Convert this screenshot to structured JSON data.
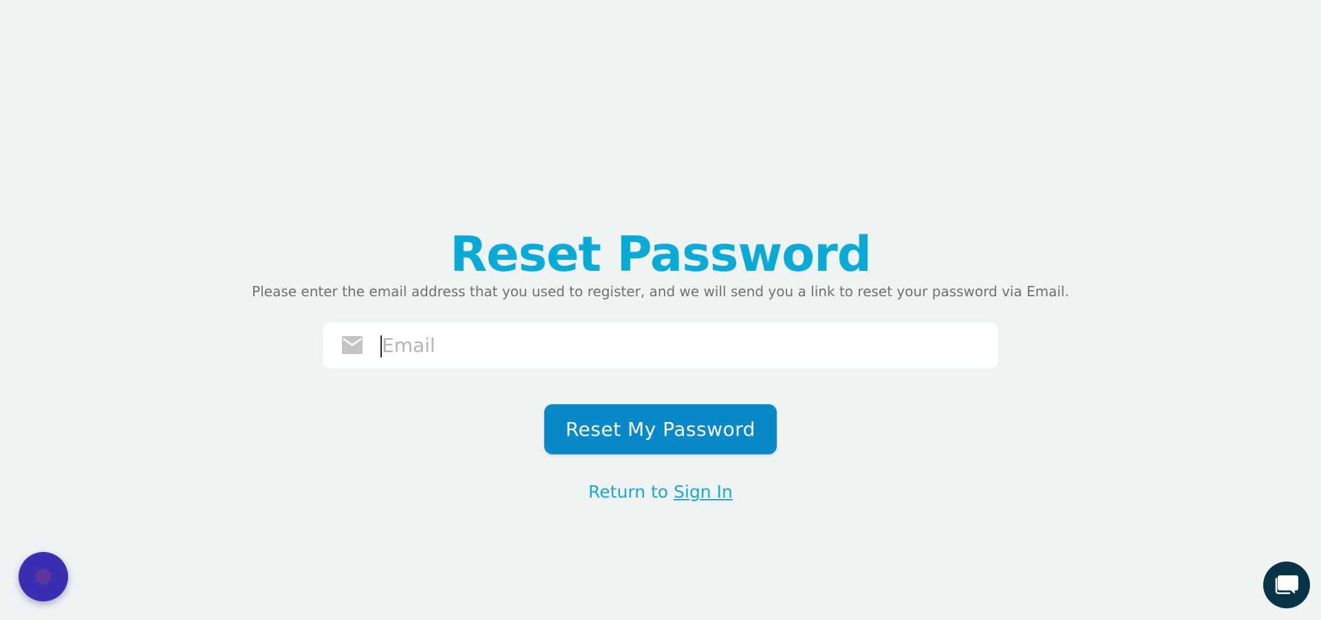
{
  "page": {
    "title": "Reset Password",
    "subtitle": "Please enter the email address that you used to register, and we will send you a link to reset your password via Email."
  },
  "form": {
    "email_placeholder": "Email",
    "email_value": "",
    "email_icon": "mail-icon",
    "submit_label": "Reset My Password"
  },
  "footer": {
    "return_prefix": "Return to ",
    "signin_label": "Sign In"
  },
  "widgets": {
    "left_fab_icon": "dot-icon",
    "chat_icon": "chat-bubble-icon"
  },
  "colors": {
    "background": "#eff3f4",
    "title": "#0aaad6",
    "button": "#0788c9",
    "link": "#1ba6d4",
    "left_fab": "#3a2fb0",
    "chat_fab": "#073347"
  }
}
